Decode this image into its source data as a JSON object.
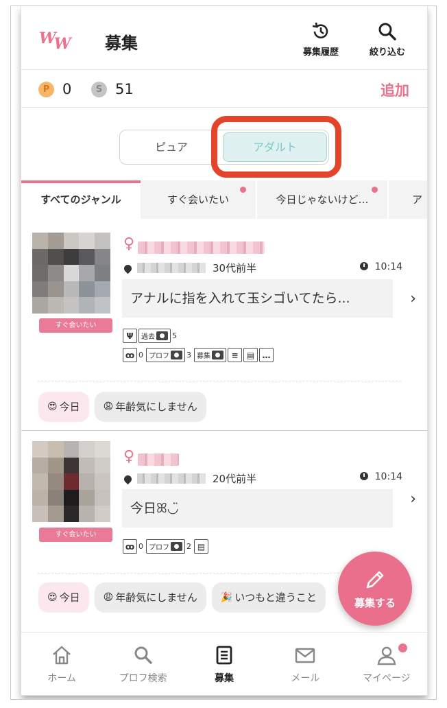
{
  "header": {
    "logo": "WW",
    "title": "募集",
    "history_label": "募集履歴",
    "filter_label": "絞り込む"
  },
  "points": {
    "p_symbol": "P",
    "p_value": "0",
    "s_symbol": "S",
    "s_value": "51",
    "add_label": "追加"
  },
  "mode_toggle": {
    "pure_label": "ピュア",
    "adult_label": "アダルト",
    "selected": "アダルト"
  },
  "genre_tabs": [
    {
      "label": "すべてのジャンル",
      "active": true,
      "unread": false
    },
    {
      "label": "すぐ会いたい",
      "active": false,
      "unread": true
    },
    {
      "label": "今日じゃないけど…",
      "active": false,
      "unread": true
    },
    {
      "label": "ア",
      "active": false,
      "unread": false
    }
  ],
  "posts": [
    {
      "badge": "すぐ会いたい",
      "gender_symbol": "♀",
      "age": "30代前半",
      "time": "10:14",
      "message": "アナルに指を入れて玉シゴいてたら...",
      "icons_row1": {
        "past_label": "過去",
        "past_count": "5"
      },
      "icons_row2": {
        "glasses_count": "0",
        "prof_label": "プロフ",
        "prof_count": "3",
        "recruit_label": "募集"
      },
      "tags": [
        {
          "emoji": "😍",
          "label": "今日"
        },
        {
          "emoji": "😩",
          "label": "年齢気にしません"
        }
      ]
    },
    {
      "badge": "すぐ会いたい",
      "gender_symbol": "♀",
      "age": "20代前半",
      "time": "10:14",
      "message": "今日ꕤ◡̈",
      "icons_row2": {
        "glasses_count": "0",
        "prof_label": "プロフ",
        "prof_count": "2"
      },
      "tags": [
        {
          "emoji": "😍",
          "label": "今日"
        },
        {
          "emoji": "😩",
          "label": "年齢気にしません"
        },
        {
          "emoji": "🎉",
          "label": "いつもと違うこと"
        }
      ]
    }
  ],
  "fab": {
    "label": "募集する"
  },
  "bottom_nav": [
    {
      "label": "ホーム",
      "icon": "home-icon",
      "active": false
    },
    {
      "label": "プロフ検索",
      "icon": "search-icon",
      "active": false
    },
    {
      "label": "募集",
      "icon": "list-icon",
      "active": true
    },
    {
      "label": "メール",
      "icon": "mail-icon",
      "active": false
    },
    {
      "label": "マイページ",
      "icon": "person-icon",
      "active": false,
      "unread": true
    }
  ],
  "colors": {
    "accent": "#e7738f",
    "adult_tab": "#dff1f1",
    "highlight_box": "#e4442a"
  }
}
